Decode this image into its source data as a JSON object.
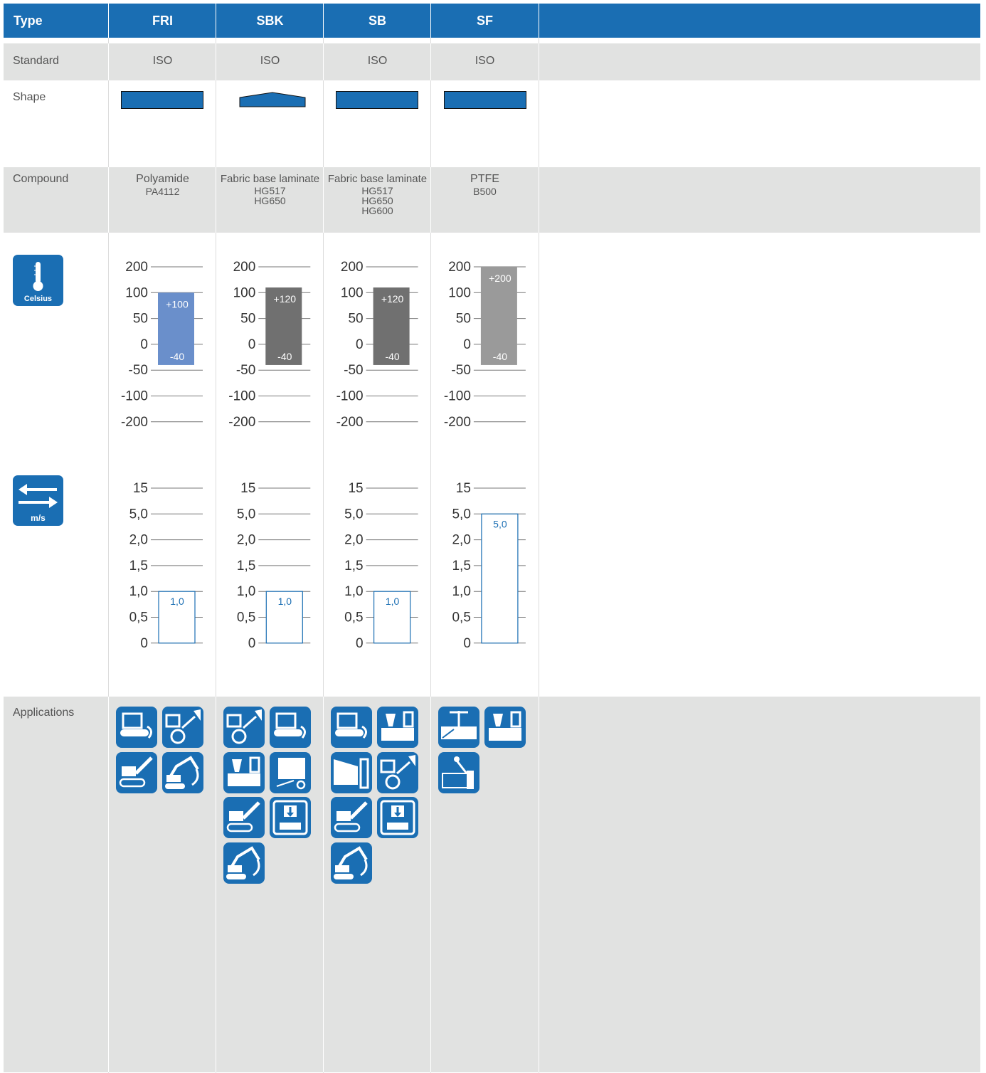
{
  "header": {
    "type_label": "Type",
    "columns": [
      "FRI",
      "SBK",
      "SB",
      "SF"
    ]
  },
  "rows": {
    "standard": "Standard",
    "shape": "Shape",
    "compound": "Compound",
    "applications": "Applications"
  },
  "standards": [
    "ISO",
    "ISO",
    "ISO",
    "ISO"
  ],
  "compounds": [
    {
      "name": "Polyamide",
      "codes": "PA4112"
    },
    {
      "name": "Fabric base laminate",
      "codes": "HG517\nHG650"
    },
    {
      "name": "Fabric base laminate",
      "codes": "HG517\nHG650\nHG600"
    },
    {
      "name": "PTFE",
      "codes": "B500"
    }
  ],
  "icons": {
    "temperature": {
      "name": "thermometer-icon",
      "label": "Celsius"
    },
    "speed": {
      "name": "speed-arrows-icon",
      "label": "m/s"
    }
  },
  "chart_data": [
    {
      "type": "bar",
      "title": "",
      "ticks": [
        "200",
        "100",
        "50",
        "0",
        "-50",
        "-100",
        "-200"
      ],
      "categories": [
        "FRI",
        "SBK",
        "SB",
        "SF"
      ],
      "ranges": [
        {
          "min": -40,
          "max": 100,
          "min_label": "-40",
          "max_label": "+100",
          "color": "#6a8fcb"
        },
        {
          "min": -40,
          "max": 120,
          "min_label": "-40",
          "max_label": "+120",
          "color": "#707070"
        },
        {
          "min": -40,
          "max": 120,
          "min_label": "-40",
          "max_label": "+120",
          "color": "#707070"
        },
        {
          "min": -40,
          "max": 200,
          "min_label": "-40",
          "max_label": "+200",
          "color": "#9a9a9a"
        }
      ]
    },
    {
      "type": "bar",
      "title": "",
      "ticks": [
        "15",
        "5,0",
        "2,0",
        "1,5",
        "1,0",
        "0,5",
        "0"
      ],
      "categories": [
        "FRI",
        "SBK",
        "SB",
        "SF"
      ],
      "ranges": [
        {
          "min": 0,
          "max": 1.0,
          "max_label": "1,0"
        },
        {
          "min": 0,
          "max": 1.0,
          "max_label": "1,0"
        },
        {
          "min": 0,
          "max": 1.0,
          "max_label": "1,0"
        },
        {
          "min": 0,
          "max": 5.0,
          "max_label": "5,0"
        }
      ]
    }
  ],
  "applications": [
    [
      "crawler-dozer-icon",
      "wheel-loader-icon",
      "tracked-loader-icon",
      "excavator-icon"
    ],
    [
      "wheel-loader-icon",
      "crawler-dozer-icon",
      "injection-molding-icon",
      "forklift-icon",
      "tracked-loader-icon",
      "press-icon",
      "excavator-icon"
    ],
    [
      "crawler-dozer-icon",
      "injection-molding-icon",
      "hydraulic-cylinder-icon",
      "wheel-loader-icon",
      "tracked-loader-icon",
      "press-icon",
      "excavator-icon"
    ],
    [
      "valve-icon",
      "injection-molding-icon",
      "hydraulic-pump-icon"
    ]
  ]
}
